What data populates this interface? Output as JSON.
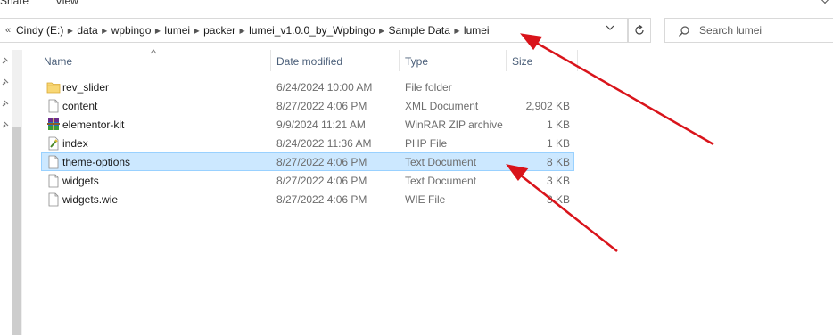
{
  "ribbon": {
    "share_label": "Share",
    "view_label": "View"
  },
  "address": {
    "overflow_label": "«",
    "path": [
      "Cindy (E:)",
      "data",
      "wpbingo",
      "lumei",
      "packer",
      "lumei_v1.0.0_by_Wpbingo",
      "Sample Data",
      "lumei"
    ],
    "separator": "▶"
  },
  "search": {
    "placeholder": "Search lumei"
  },
  "columns": {
    "name": "Name",
    "date": "Date modified",
    "type": "Type",
    "size": "Size"
  },
  "files": [
    {
      "name": "rev_slider",
      "date": "6/24/2024 10:00 AM",
      "type": "File folder",
      "size": "",
      "icon": "folder-icon"
    },
    {
      "name": "content",
      "date": "8/27/2022 4:06 PM",
      "type": "XML Document",
      "size": "2,902 KB",
      "icon": "document-icon"
    },
    {
      "name": "elementor-kit",
      "date": "9/9/2024 11:21 AM",
      "type": "WinRAR ZIP archive",
      "size": "1 KB",
      "icon": "winrar-icon"
    },
    {
      "name": "index",
      "date": "8/24/2022 11:36 AM",
      "type": "PHP File",
      "size": "1 KB",
      "icon": "php-file-icon"
    },
    {
      "name": "theme-options",
      "date": "8/27/2022 4:06 PM",
      "type": "Text Document",
      "size": "8 KB",
      "icon": "document-icon",
      "selected": true
    },
    {
      "name": "widgets",
      "date": "8/27/2022 4:06 PM",
      "type": "Text Document",
      "size": "3 KB",
      "icon": "document-icon"
    },
    {
      "name": "widgets.wie",
      "date": "8/27/2022 4:06 PM",
      "type": "WIE File",
      "size": "3 KB",
      "icon": "document-icon"
    }
  ],
  "colors": {
    "selection_bg": "#cce8ff",
    "selection_border": "#99d1ff",
    "header_text": "#4c607a",
    "annotation_arrow": "#d9141b"
  }
}
